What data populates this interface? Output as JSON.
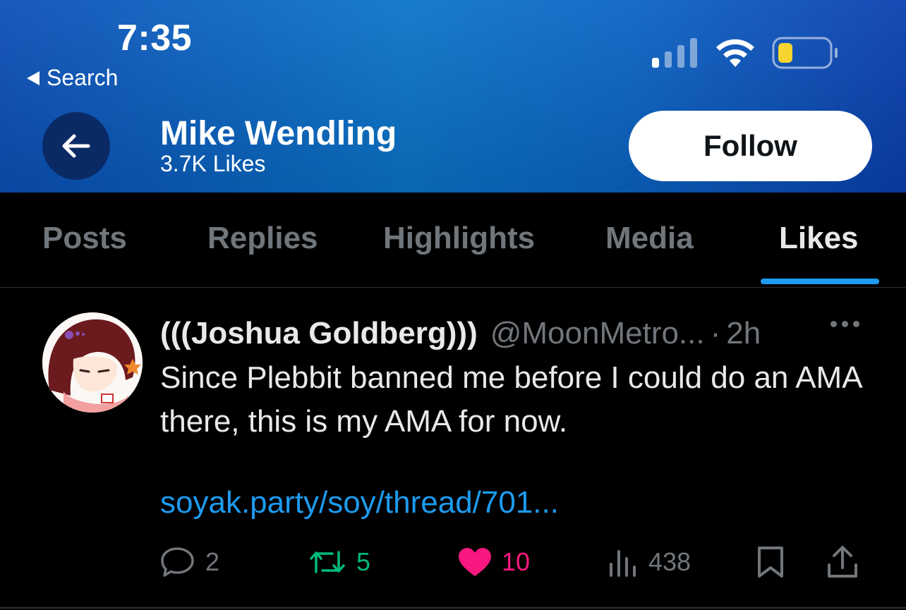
{
  "status_bar": {
    "time": "7:35",
    "back_label": "Search"
  },
  "header": {
    "name": "Mike Wendling",
    "subtitle": "3.7K Likes",
    "follow_label": "Follow"
  },
  "tabs": [
    {
      "label": "Posts",
      "active": false
    },
    {
      "label": "Replies",
      "active": false
    },
    {
      "label": "Highlights",
      "active": false
    },
    {
      "label": "Media",
      "active": false
    },
    {
      "label": "Likes",
      "active": true
    }
  ],
  "tweet": {
    "author_name": "(((Joshua Goldberg)))",
    "handle": "@MoonMetro...",
    "separator": "·",
    "time": "2h",
    "text": "Since Plebbit banned me before I could do an AMA there, this is my AMA for now.",
    "link": "soyak.party/soy/thread/701...",
    "replies": "2",
    "reposts": "5",
    "likes": "10",
    "views": "438"
  },
  "colors": {
    "accent": "#1d9bf0",
    "repost": "#00ba7c",
    "like": "#f91880",
    "muted": "#71767b"
  }
}
